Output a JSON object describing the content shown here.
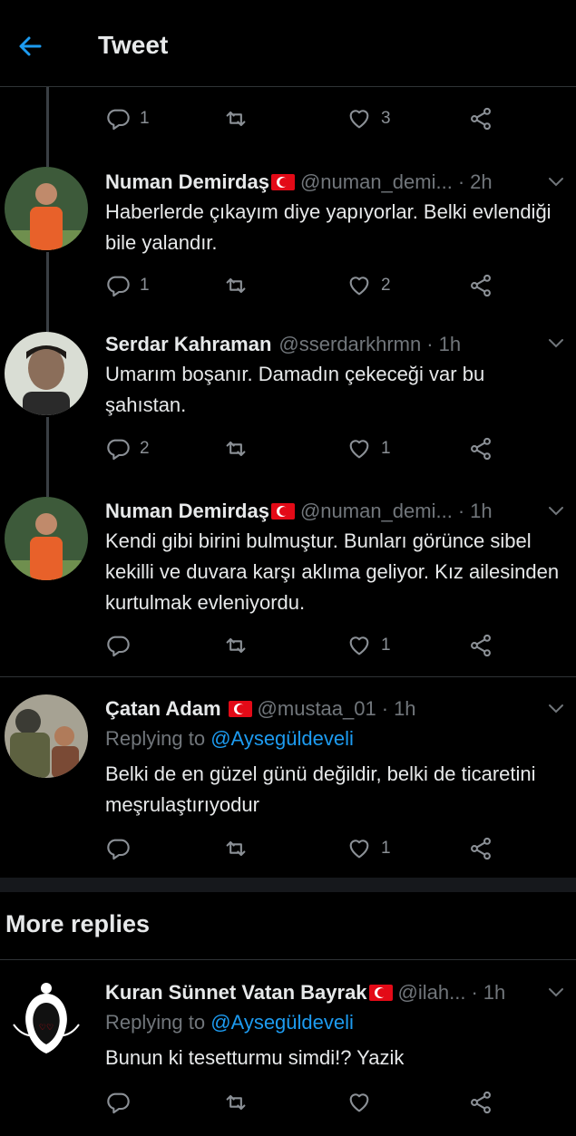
{
  "header": {
    "title": "Tweet"
  },
  "top_actions": {
    "reply": "1",
    "retweet": "",
    "like": "3"
  },
  "tweets": [
    {
      "name": "Numan Demirdaş",
      "handle": "@numan_demi...",
      "dot": "·",
      "time": "2h",
      "text": "Haberlerde çıkayım diye yapıyorlar. Belki evlendiği bile yalandır.",
      "reply_count": "1",
      "retweet_count": "",
      "like_count": "2"
    },
    {
      "name": "Serdar Kahraman",
      "handle": "@sserdarkhrmn",
      "dot": "·",
      "time": "1h",
      "text": "Umarım boşanır. Damadın çekeceği var bu şahıstan.",
      "reply_count": "2",
      "retweet_count": "",
      "like_count": "1"
    },
    {
      "name": "Numan Demirdaş",
      "handle": "@numan_demi...",
      "dot": "·",
      "time": "1h",
      "text": "Kendi gibi birini bulmuştur. Bunları görünce sibel kekilli ve duvara karşı aklıma geliyor. Kız ailesinden kurtulmak evleniyordu.",
      "reply_count": "",
      "retweet_count": "",
      "like_count": "1"
    },
    {
      "name": "Çatan Adam",
      "handle": "@mustaa_01",
      "dot": "·",
      "time": "1h",
      "replying_prefix": "Replying to",
      "replying_to": "@Aysegüldeveli",
      "text": "Belki de en güzel günü değildir, belki de ticaretini meşrulaştırıyodur",
      "reply_count": "",
      "retweet_count": "",
      "like_count": "1"
    }
  ],
  "more_replies": {
    "title": "More replies",
    "tweet": {
      "name": "Kuran Sünnet Vatan Bayrak",
      "handle": "@ilah...",
      "dot": "·",
      "time": "1h",
      "replying_prefix": "Replying to",
      "replying_to": "@Aysegüldeveli",
      "text": "Bunun ki tesetturmu simdi!? Yazik"
    }
  },
  "colors": {
    "accent": "#1d9bf0",
    "background": "#000000",
    "muted": "#71767b",
    "flag_red": "#e30a17"
  },
  "icons": [
    "back-arrow-icon",
    "reply-icon",
    "retweet-icon",
    "like-icon",
    "share-icon",
    "chevron-down-icon",
    "turkish-flag-icon"
  ]
}
